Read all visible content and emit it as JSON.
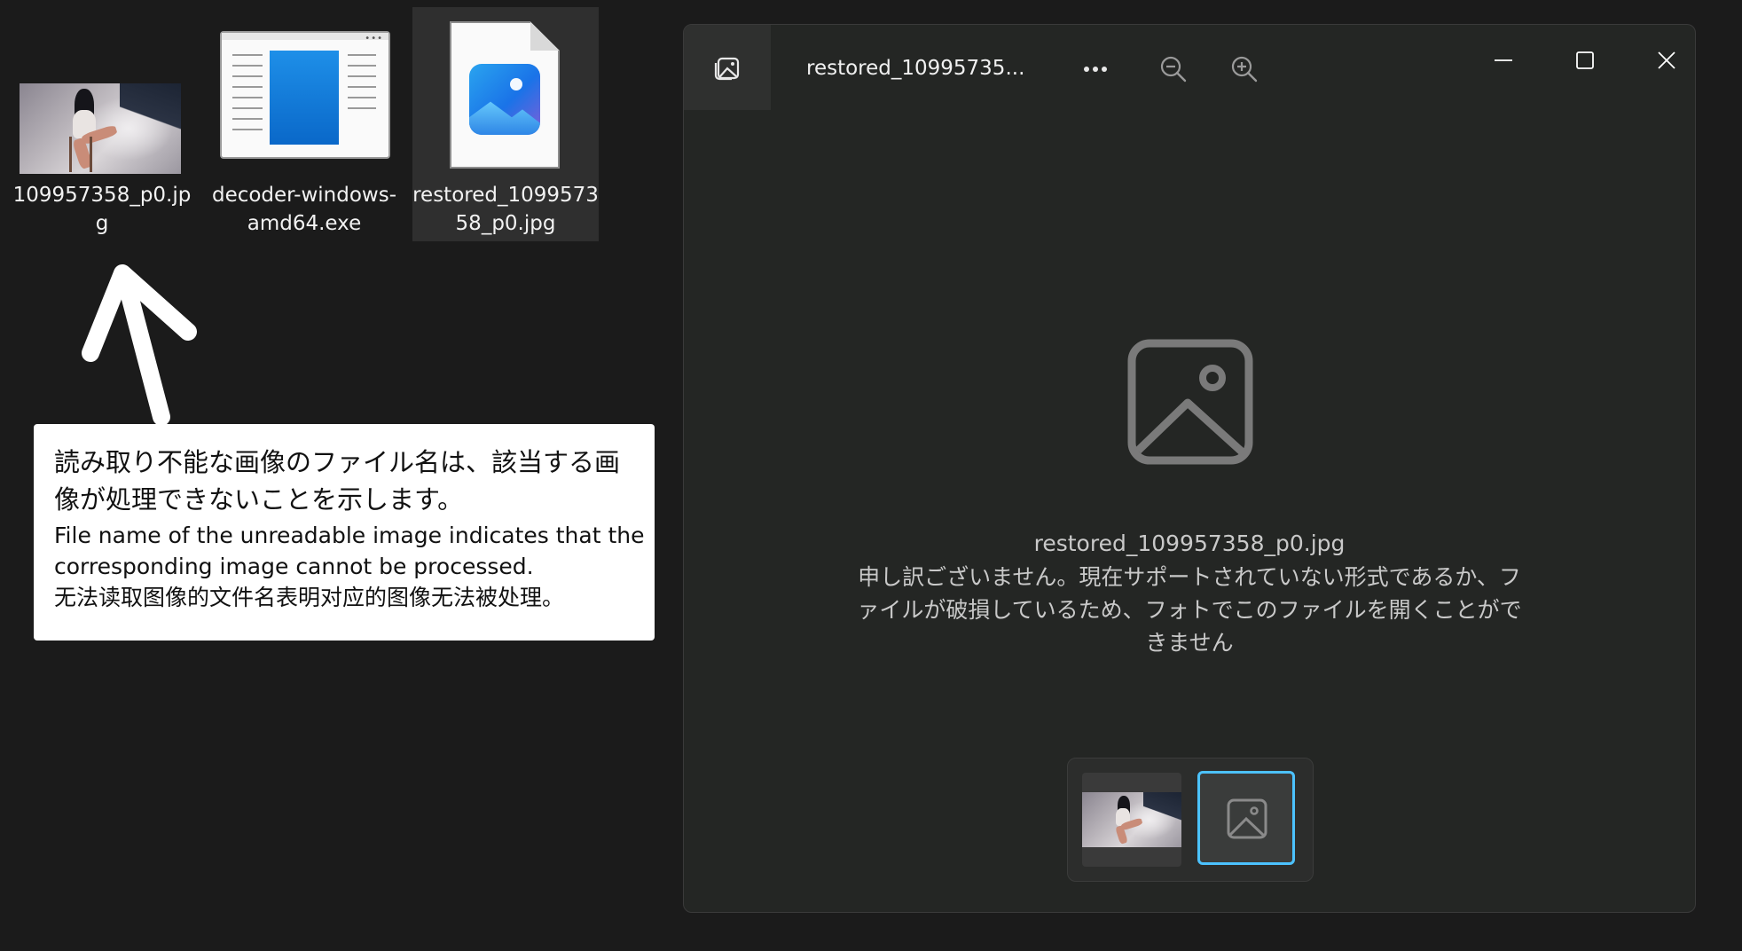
{
  "desktop": {
    "icons": [
      {
        "label": "109957358_p0.jpg",
        "type": "photo-thumbnail"
      },
      {
        "label": "decoder-windows-amd64.exe",
        "type": "exe-icon"
      },
      {
        "label": "restored_109957358_p0.jpg",
        "type": "photos-file-icon",
        "selected": true
      }
    ]
  },
  "callout": {
    "jp": "読み取り不能な画像のファイル名は、該当する画像が処理できないことを示します。",
    "en": "File name of the unreadable image indicates that the corresponding image cannot be processed.",
    "zh": "无法读取图像的文件名表明对应的图像无法被处理。"
  },
  "viewer": {
    "title": "restored_10995735...",
    "toolbar": {
      "more_icon": "more-icon",
      "zoom_out_icon": "zoom-out-icon",
      "zoom_in_icon": "zoom-in-icon"
    },
    "window_controls": [
      "minimize-icon",
      "maximize-icon",
      "close-icon"
    ],
    "file_name": "restored_109957358_p0.jpg",
    "error_message": "申し訳ございません。現在サポートされていない形式であるか、ファイルが破損しているため、フォトでこのファイルを開くことができません",
    "accent_color": "#4cc2ff"
  }
}
